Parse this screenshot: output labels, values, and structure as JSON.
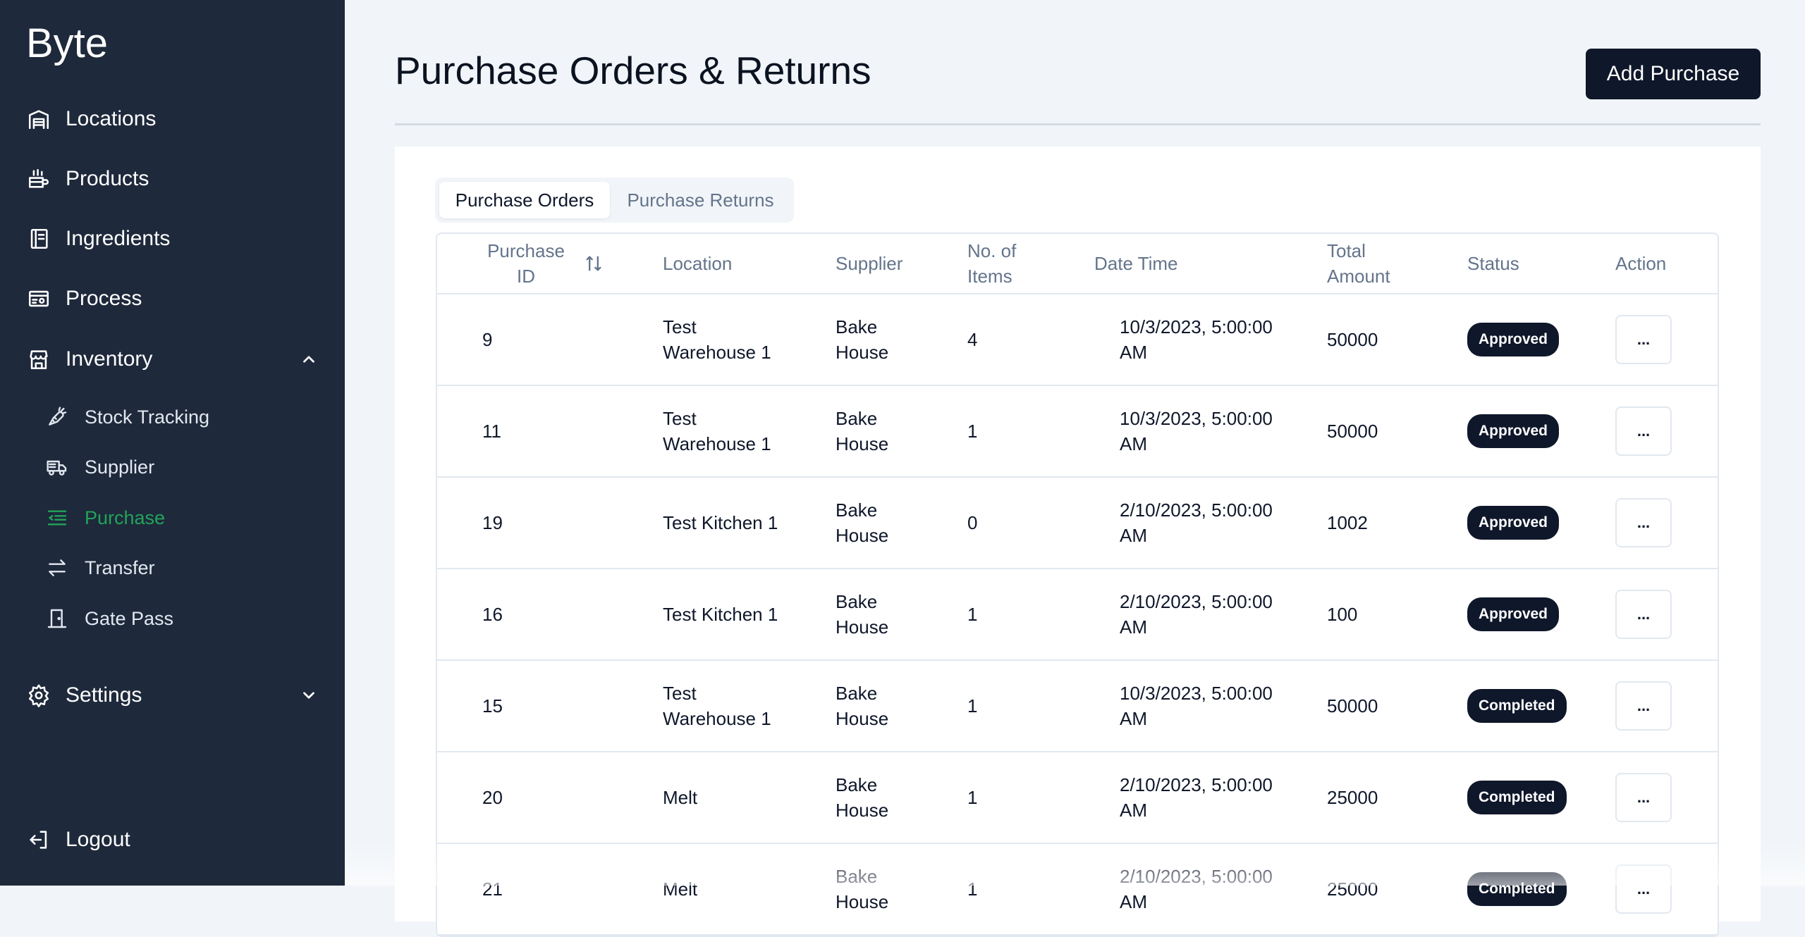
{
  "sidebar": {
    "brand": "Byte",
    "nav": [
      {
        "label": "Locations",
        "icon": "warehouse-icon"
      },
      {
        "label": "Products",
        "icon": "food-icon"
      },
      {
        "label": "Ingredients",
        "icon": "notebook-icon"
      },
      {
        "label": "Process",
        "icon": "process-icon"
      },
      {
        "label": "Inventory",
        "icon": "store-icon",
        "expanded": true
      }
    ],
    "sub": [
      {
        "label": "Stock Tracking",
        "icon": "carrot-icon"
      },
      {
        "label": "Supplier",
        "icon": "truck-icon"
      },
      {
        "label": "Purchase",
        "icon": "list-indent-icon",
        "active": true
      },
      {
        "label": "Transfer",
        "icon": "arrows-exchange-icon"
      },
      {
        "label": "Gate Pass",
        "icon": "door-icon"
      }
    ],
    "settings": {
      "label": "Settings",
      "icon": "gear-icon"
    },
    "logout": {
      "label": "Logout",
      "icon": "logout-icon"
    },
    "active_color": "#22a35a"
  },
  "header": {
    "title": "Purchase Orders & Returns",
    "add_button": "Add Purchase"
  },
  "tabs": {
    "active": "Purchase Orders",
    "inactive": "Purchase Returns"
  },
  "table": {
    "columns": {
      "id_line1": "Purchase",
      "id_line2": "ID",
      "location": "Location",
      "supplier": "Supplier",
      "items_line1": "No. of",
      "items_line2": "Items",
      "datetime": "Date Time",
      "total_line1": "Total",
      "total_line2": "Amount",
      "status": "Status",
      "action": "Action"
    },
    "rows": [
      {
        "id": "9",
        "loc1": "Test",
        "loc2": "Warehouse 1",
        "sup1": "Bake",
        "sup2": "House",
        "items": "4",
        "dt1": "10/3/2023, 5:00:00",
        "dt2": "AM",
        "total": "50000",
        "status": "Approved",
        "action": "..."
      },
      {
        "id": "11",
        "loc1": "Test",
        "loc2": "Warehouse 1",
        "sup1": "Bake",
        "sup2": "House",
        "items": "1",
        "dt1": "10/3/2023, 5:00:00",
        "dt2": "AM",
        "total": "50000",
        "status": "Approved",
        "action": "..."
      },
      {
        "id": "19",
        "loc1": "Test Kitchen 1",
        "loc2": "",
        "sup1": "Bake",
        "sup2": "House",
        "items": "0",
        "dt1": "2/10/2023, 5:00:00",
        "dt2": "AM",
        "total": "1002",
        "status": "Approved",
        "action": "..."
      },
      {
        "id": "16",
        "loc1": "Test Kitchen 1",
        "loc2": "",
        "sup1": "Bake",
        "sup2": "House",
        "items": "1",
        "dt1": "2/10/2023, 5:00:00",
        "dt2": "AM",
        "total": "100",
        "status": "Approved",
        "action": "..."
      },
      {
        "id": "15",
        "loc1": "Test",
        "loc2": "Warehouse 1",
        "sup1": "Bake",
        "sup2": "House",
        "items": "1",
        "dt1": "10/3/2023, 5:00:00",
        "dt2": "AM",
        "total": "50000",
        "status": "Completed",
        "action": "..."
      },
      {
        "id": "20",
        "loc1": "Melt",
        "loc2": "",
        "sup1": "Bake",
        "sup2": "House",
        "items": "1",
        "dt1": "2/10/2023, 5:00:00",
        "dt2": "AM",
        "total": "25000",
        "status": "Completed",
        "action": "..."
      },
      {
        "id": "21",
        "loc1": "Melt",
        "loc2": "",
        "sup1": "Bake",
        "sup2": "House",
        "items": "1",
        "dt1": "2/10/2023, 5:00:00",
        "dt2": "AM",
        "total": "25000",
        "status": "Completed",
        "action": "..."
      }
    ]
  }
}
